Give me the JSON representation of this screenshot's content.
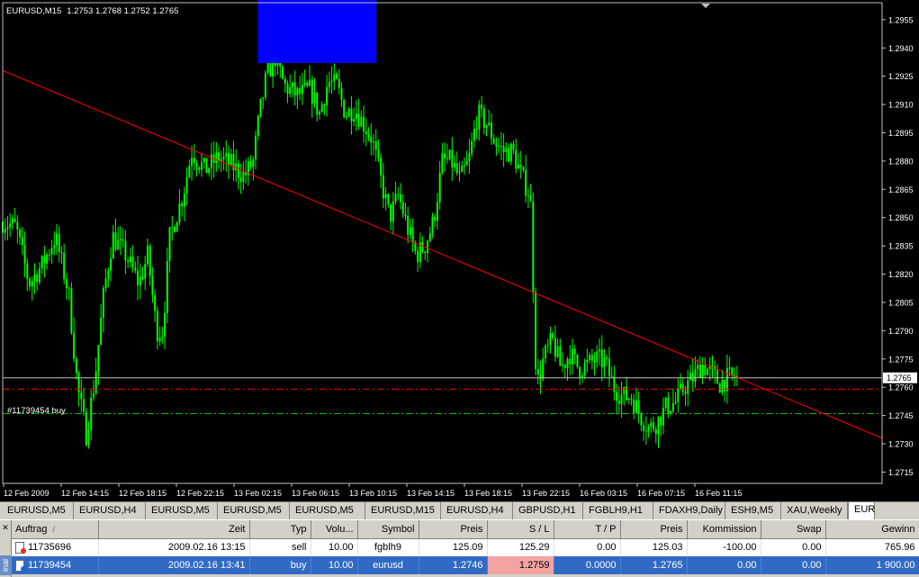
{
  "chart": {
    "symbol_label": "EURUSD,M15",
    "ohlc_label": "1.2753 1.2768 1.2752 1.2765",
    "current_price_label": "1.2765",
    "order_label": "#11739454 buy",
    "price_levels": [
      "1.2955",
      "1.2940",
      "1.2925",
      "1.2910",
      "1.2895",
      "1.2880",
      "1.2865",
      "1.2850",
      "1.2835",
      "1.2820",
      "1.2805",
      "1.2790",
      "1.2775",
      "1.2760",
      "1.2745",
      "1.2730",
      "1.2715"
    ],
    "time_labels": [
      "12 Feb 2009",
      "12 Feb 14:15",
      "12 Feb 18:15",
      "12 Feb 22:15",
      "13 Feb 02:15",
      "13 Feb 06:15",
      "13 Feb 10:15",
      "13 Feb 14:15",
      "13 Feb 18:15",
      "13 Feb 22:15",
      "16 Feb 03:15",
      "16 Feb 07:15",
      "16 Feb 11:15"
    ],
    "colors": {
      "background": "#000000",
      "candles": "#00ff00",
      "trendline": "#ff0000",
      "sl_line": "#ff0000",
      "open_line": "#00c000",
      "bid_line": "#c0c0c0",
      "rectangle": "#0000ff",
      "axis_text": "#ffffff"
    }
  },
  "chart_data": {
    "type": "candlestick",
    "symbol": "EURUSD",
    "timeframe": "M15",
    "ylim": [
      1.2709,
      1.2964
    ],
    "levels": {
      "stop_loss": 1.2759,
      "open_price": 1.2746,
      "bid": 1.2765
    },
    "trendline": {
      "from": [
        0,
        1.2928
      ],
      "to": [
        1.0,
        1.2733
      ]
    },
    "rectangle": {
      "x": [
        0.29,
        0.425
      ],
      "y": [
        1.2932,
        1.2968
      ]
    },
    "close_path": [
      [
        0.0,
        1.2848
      ],
      [
        0.015,
        1.2845
      ],
      [
        0.03,
        1.2815
      ],
      [
        0.045,
        1.2825
      ],
      [
        0.06,
        1.284
      ],
      [
        0.075,
        1.281
      ],
      [
        0.085,
        1.276
      ],
      [
        0.095,
        1.2735
      ],
      [
        0.105,
        1.2765
      ],
      [
        0.115,
        1.281
      ],
      [
        0.125,
        1.284
      ],
      [
        0.14,
        1.283
      ],
      [
        0.155,
        1.2815
      ],
      [
        0.165,
        1.283
      ],
      [
        0.175,
        1.279
      ],
      [
        0.182,
        1.279
      ],
      [
        0.19,
        1.284
      ],
      [
        0.205,
        1.2862
      ],
      [
        0.215,
        1.2885
      ],
      [
        0.23,
        1.2875
      ],
      [
        0.245,
        1.2882
      ],
      [
        0.26,
        1.2878
      ],
      [
        0.275,
        1.2872
      ],
      [
        0.285,
        1.288
      ],
      [
        0.292,
        1.2905
      ],
      [
        0.3,
        1.2925
      ],
      [
        0.31,
        1.2935
      ],
      [
        0.32,
        1.292
      ],
      [
        0.335,
        1.2915
      ],
      [
        0.35,
        1.2918
      ],
      [
        0.36,
        1.2905
      ],
      [
        0.37,
        1.2922
      ],
      [
        0.38,
        1.292
      ],
      [
        0.39,
        1.2905
      ],
      [
        0.4,
        1.2908
      ],
      [
        0.41,
        1.29
      ],
      [
        0.42,
        1.2892
      ],
      [
        0.43,
        1.287
      ],
      [
        0.44,
        1.285
      ],
      [
        0.45,
        1.2862
      ],
      [
        0.46,
        1.2845
      ],
      [
        0.47,
        1.283
      ],
      [
        0.48,
        1.2835
      ],
      [
        0.49,
        1.2848
      ],
      [
        0.5,
        1.288
      ],
      [
        0.51,
        1.288
      ],
      [
        0.52,
        1.287
      ],
      [
        0.53,
        1.288
      ],
      [
        0.54,
        1.2905
      ],
      [
        0.55,
        1.29
      ],
      [
        0.56,
        1.289
      ],
      [
        0.57,
        1.2885
      ],
      [
        0.58,
        1.2885
      ],
      [
        0.59,
        1.2872
      ],
      [
        0.6,
        1.2862
      ],
      [
        0.607,
        1.276
      ],
      [
        0.615,
        1.2775
      ],
      [
        0.625,
        1.2785
      ],
      [
        0.635,
        1.277
      ],
      [
        0.645,
        1.2778
      ],
      [
        0.655,
        1.277
      ],
      [
        0.665,
        1.2772
      ],
      [
        0.675,
        1.2775
      ],
      [
        0.685,
        1.2773
      ],
      [
        0.695,
        1.276
      ],
      [
        0.705,
        1.2755
      ],
      [
        0.715,
        1.2755
      ],
      [
        0.725,
        1.2745
      ],
      [
        0.735,
        1.2738
      ],
      [
        0.745,
        1.2742
      ],
      [
        0.755,
        1.275
      ],
      [
        0.765,
        1.2752
      ],
      [
        0.775,
        1.276
      ],
      [
        0.785,
        1.2765
      ],
      [
        0.795,
        1.2772
      ],
      [
        0.805,
        1.2768
      ],
      [
        0.815,
        1.2762
      ],
      [
        0.825,
        1.2765
      ],
      [
        0.835,
        1.2765
      ]
    ]
  },
  "tabs": [
    "EURUSD,M5",
    "EURUSD,H4",
    "EURUSD,M5",
    "EURUSD,M5",
    "EURUSD,M5",
    "EURUSD,M15",
    "EURUSD,H4",
    "GBPUSD,H1",
    "FGBLH9,H1",
    "FDAXH9,Daily",
    "ESH9,M5",
    "XAU,Weekly",
    "EUR"
  ],
  "active_tab_index": 12,
  "terminal": {
    "side_label": "inal",
    "columns": [
      "Auftrag",
      "Zeit",
      "Typ",
      "Volu...",
      "Symbol",
      "Preis",
      "S / L",
      "T / P",
      "Preis",
      "Kommission",
      "Swap",
      "Gewinn"
    ],
    "rows": [
      {
        "ticket": "11735696",
        "time": "2009.02.16 13:15",
        "type": "sell",
        "volume": "10.00",
        "symbol": "fgblh9",
        "price": "125.09",
        "sl": "125.29",
        "tp": "0.00",
        "cur_price": "125.03",
        "commission": "-100.00",
        "swap": "0.00",
        "profit": "765.96",
        "status": "sell"
      },
      {
        "ticket": "11739454",
        "time": "2009.02.16 13:41",
        "type": "buy",
        "volume": "10.00",
        "symbol": "eurusd",
        "price": "1.2746",
        "sl": "1.2759",
        "tp": "0.0000",
        "cur_price": "1.2765",
        "commission": "0.00",
        "swap": "0.00",
        "profit": "1 900.00",
        "status": "buy"
      }
    ]
  }
}
